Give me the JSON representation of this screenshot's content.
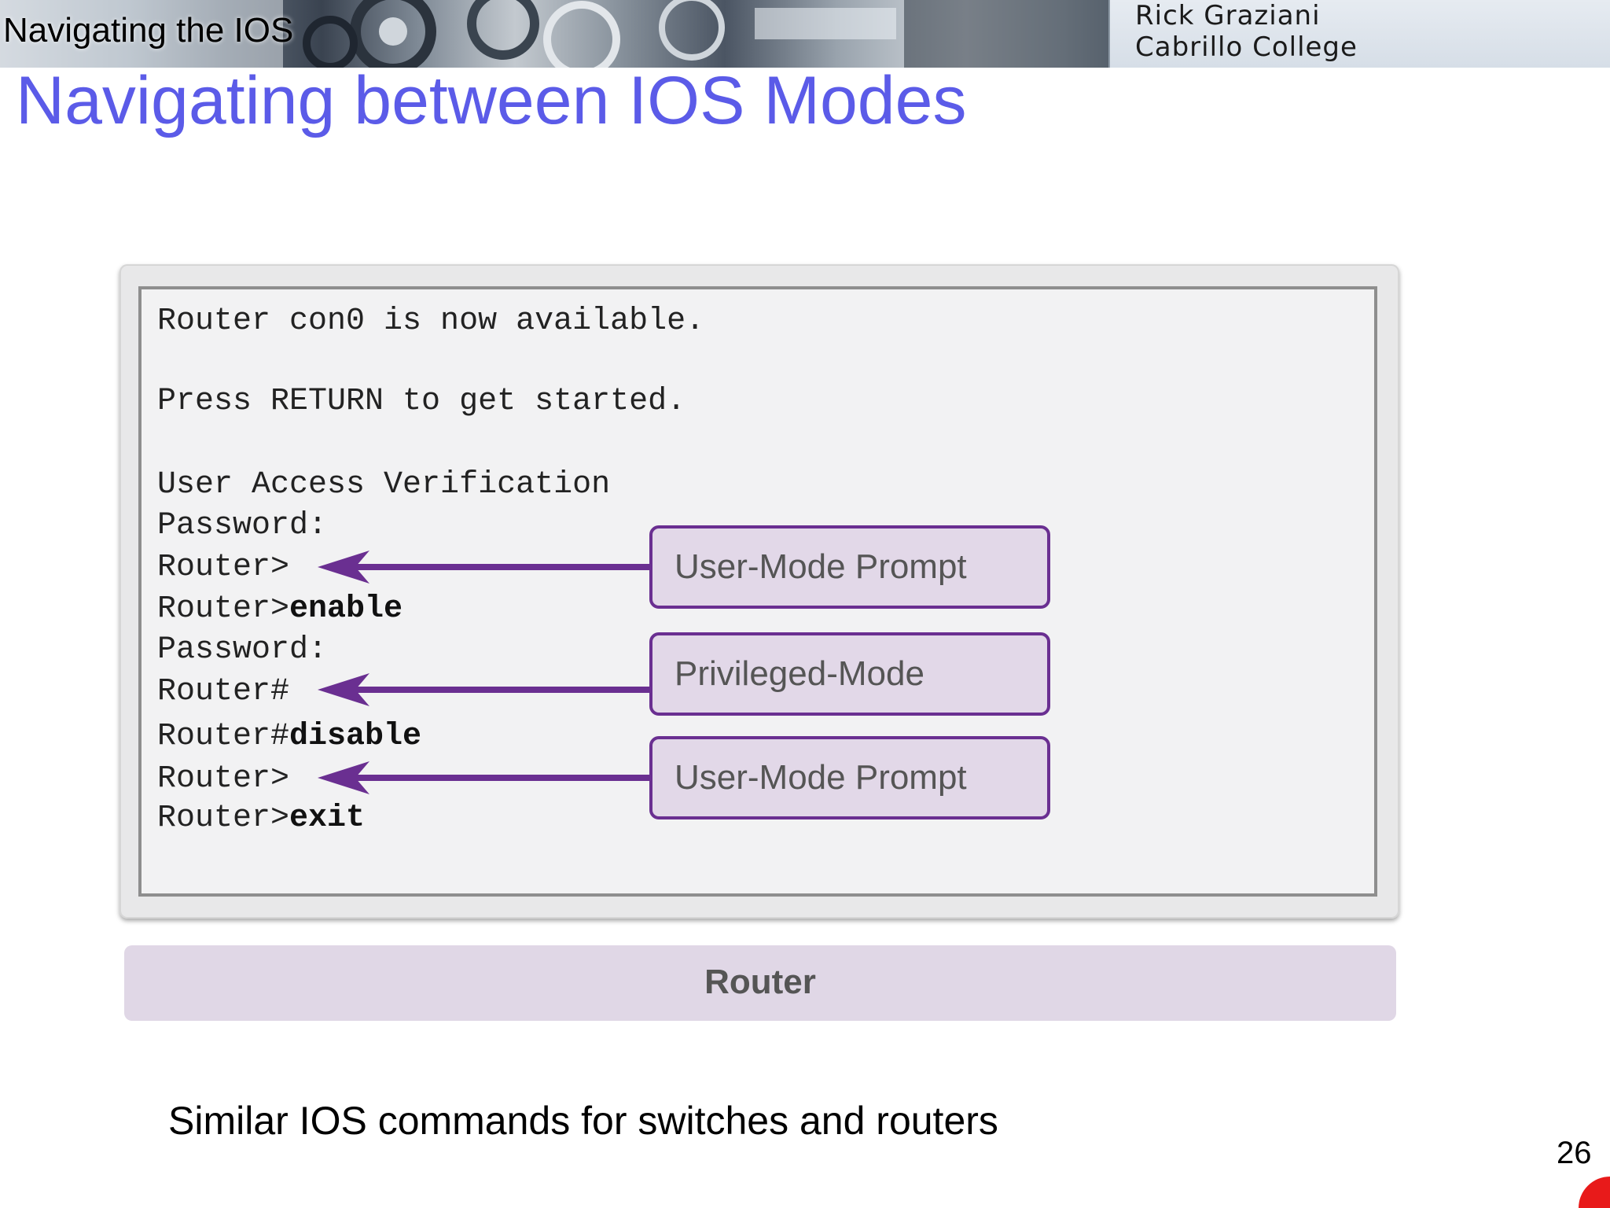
{
  "header": {
    "section_label": "Navigating the IOS",
    "author_name": "Rick Graziani",
    "author_school": "Cabrillo College"
  },
  "slide": {
    "title": "Navigating between IOS Modes",
    "footer_note": "Similar IOS commands for switches and routers",
    "page_number": "26"
  },
  "terminal": {
    "lines": [
      {
        "text": "Router con0 is now available.",
        "cmd": ""
      },
      {
        "text": "Press RETURN to get started.",
        "cmd": ""
      },
      {
        "text": "User Access Verification",
        "cmd": ""
      },
      {
        "text": "Password:",
        "cmd": ""
      },
      {
        "text": "Router>",
        "cmd": ""
      },
      {
        "text": "Router>",
        "cmd": "enable"
      },
      {
        "text": "Password:",
        "cmd": ""
      },
      {
        "text": "Router#",
        "cmd": ""
      },
      {
        "text": "Router#",
        "cmd": "disable"
      },
      {
        "text": "Router>",
        "cmd": ""
      },
      {
        "text": "Router>",
        "cmd": "exit"
      }
    ]
  },
  "callouts": [
    {
      "label": "User-Mode Prompt"
    },
    {
      "label": "Privileged-Mode"
    },
    {
      "label": "User-Mode Prompt"
    }
  ],
  "device": {
    "label": "Router"
  },
  "colors": {
    "title": "#5b5be8",
    "callout_border": "#6a2f91",
    "callout_fill": "#e2d8e8",
    "arrow": "#6a2f91",
    "device_bar": "#e0d7e6",
    "red_dot": "#e81a1a"
  }
}
